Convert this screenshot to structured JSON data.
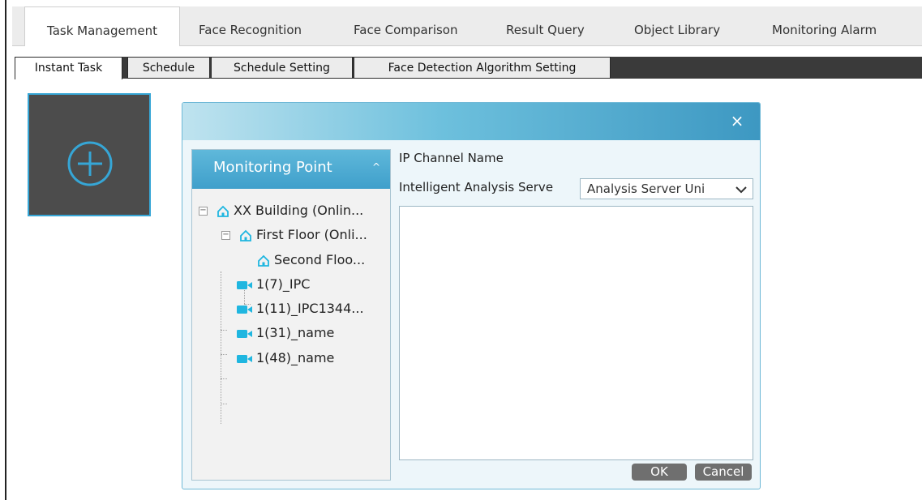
{
  "top_tabs": [
    {
      "label": "Task Management",
      "active": true
    },
    {
      "label": "Face Recognition",
      "active": false
    },
    {
      "label": "Face Comparison",
      "active": false
    },
    {
      "label": "Result Query",
      "active": false
    },
    {
      "label": "Object Library",
      "active": false
    },
    {
      "label": "Monitoring Alarm",
      "active": false
    }
  ],
  "sub_tabs": [
    {
      "label": "Instant Task",
      "active": true
    },
    {
      "label": "Schedule",
      "active": false
    },
    {
      "label": "Schedule Setting",
      "active": false
    },
    {
      "label": "Face Detection Algorithm Setting",
      "active": false
    }
  ],
  "add_tile": {
    "icon": "plus-circle-icon"
  },
  "dialog": {
    "close_label": "×",
    "tree": {
      "header": "Monitoring Point",
      "collapse_glyph": "^",
      "items": [
        {
          "label": "XX Building (Onlin...",
          "type": "area",
          "expanded": true
        },
        {
          "label": "First Floor (Onli...",
          "type": "area",
          "expanded": true
        },
        {
          "label": "Second Floo...",
          "type": "area"
        },
        {
          "label": "1(7)_IPC",
          "type": "camera"
        },
        {
          "label": "1(11)_IPC1344...",
          "type": "camera"
        },
        {
          "label": "1(31)_name",
          "type": "camera"
        },
        {
          "label": "1(48)_name",
          "type": "camera"
        }
      ]
    },
    "ip_channel_label": "IP Channel Name",
    "analysis_server_label": "Intelligent Analysis Serve",
    "analysis_server_value": "Analysis Server Uni",
    "ok_label": "OK",
    "cancel_label": "Cancel"
  },
  "colors": {
    "accent": "#3fa3cf",
    "header_gradient_end": "#3d98c2",
    "camera_icon": "#1fb6e0",
    "dark_bar": "#3a3a3a"
  }
}
